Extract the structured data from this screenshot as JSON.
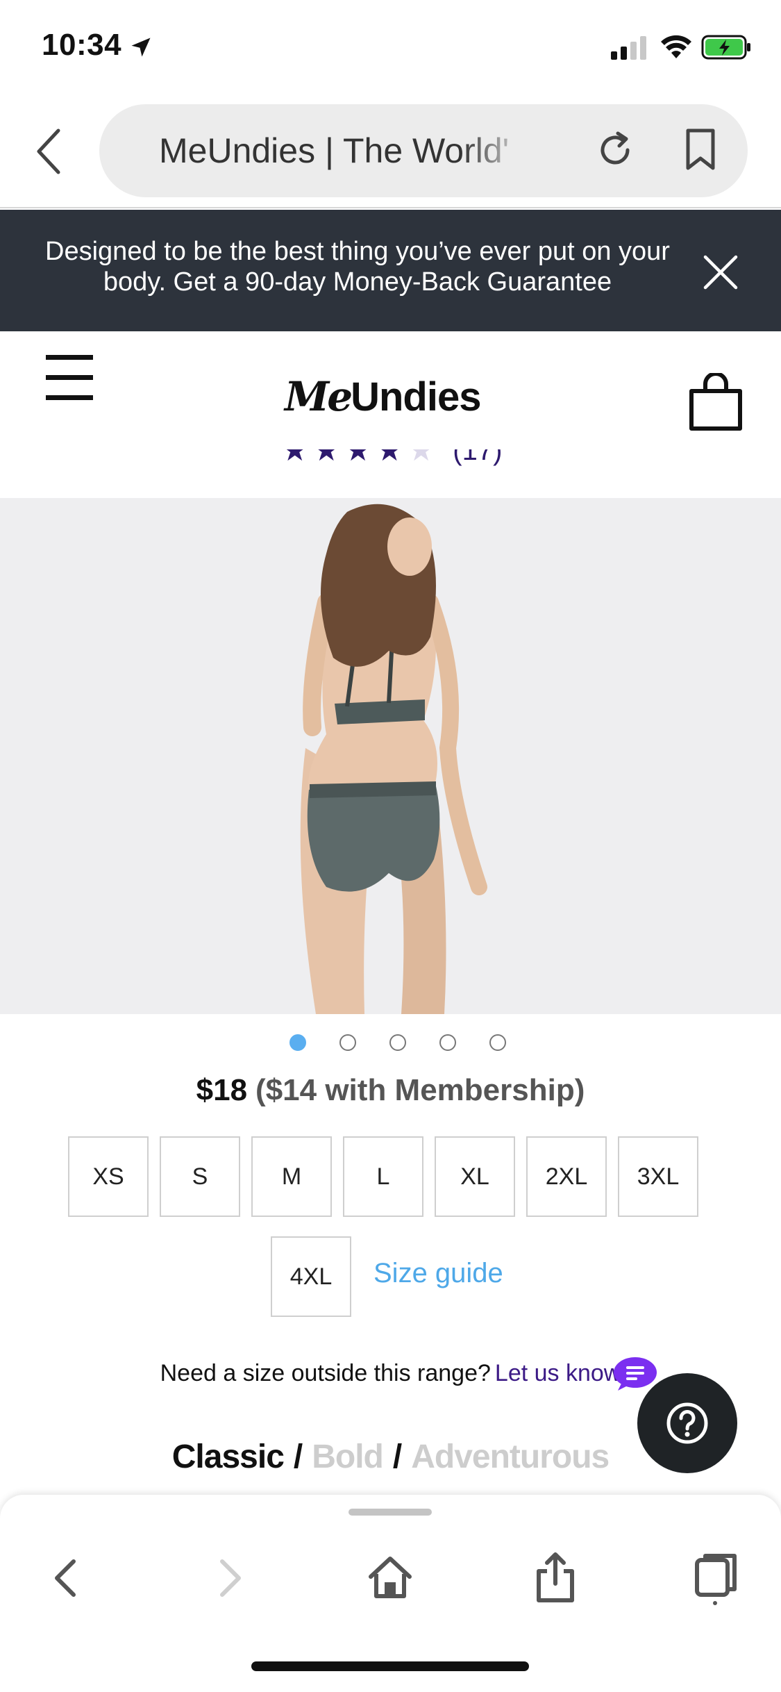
{
  "status_bar": {
    "time": "10:34",
    "icons": [
      "location-arrow-icon",
      "cellular-signal-icon",
      "wifi-icon",
      "battery-charging-icon"
    ]
  },
  "browser": {
    "url_text": "MeUndies | The World'",
    "icons": [
      "back-chevron-icon",
      "reload-icon",
      "bookmark-icon"
    ]
  },
  "promo": {
    "text": "Designed to be the best thing you’ve ever put on your body. Get a 90-day Money-Back Guarantee",
    "close_icon": "close-icon"
  },
  "header": {
    "logo_me": "Me",
    "logo_undies": "Undies",
    "icons": [
      "hamburger-menu-icon",
      "shopping-bag-icon"
    ]
  },
  "rating": {
    "stars": 4.5,
    "count_text": "(17)"
  },
  "carousel": {
    "slides": 5,
    "active_index": 0
  },
  "product": {
    "price": "$18",
    "member_price": "($14 with Membership)"
  },
  "sizes": {
    "options": [
      "XS",
      "S",
      "M",
      "L",
      "XL",
      "2XL",
      "3XL",
      "4XL"
    ],
    "size_guide_label": "Size guide"
  },
  "size_request": {
    "text": "Need a size outside this range?",
    "link": "Let us know"
  },
  "style_tabs": {
    "active": "Classic",
    "separator": "/",
    "options": [
      "Classic",
      "Bold",
      "Adventurous"
    ]
  },
  "help": {
    "icon": "question-icon"
  },
  "toolbar": {
    "icons": [
      "back-icon",
      "forward-icon",
      "home-icon",
      "share-icon",
      "tabs-icon"
    ]
  },
  "colors": {
    "promo_bg": "#2d333c",
    "accent_purple": "#3c1a86",
    "link_blue": "#4ea8e8",
    "active_dot": "#5aaef0"
  }
}
